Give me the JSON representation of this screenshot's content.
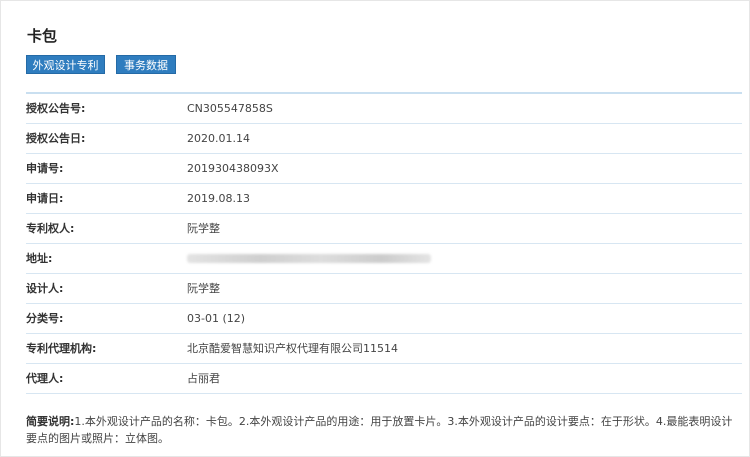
{
  "page": {
    "title": "卡包"
  },
  "buttons": {
    "design_patent": "外观设计专利",
    "transaction_data": "事务数据"
  },
  "fields": [
    {
      "label": "授权公告号:",
      "value": "CN305547858S"
    },
    {
      "label": "授权公告日:",
      "value": "2020.01.14"
    },
    {
      "label": "申请号:",
      "value": "201930438093X"
    },
    {
      "label": "申请日:",
      "value": "2019.08.13"
    },
    {
      "label": "专利权人:",
      "value": "阮学整"
    },
    {
      "label": "地址:",
      "value": ""
    },
    {
      "label": "设计人:",
      "value": "阮学整"
    },
    {
      "label": "分类号:",
      "value": "03-01 (12)"
    },
    {
      "label": "专利代理机构:",
      "value": "北京酷爱智慧知识产权代理有限公司11514"
    },
    {
      "label": "代理人:",
      "value": "占丽君"
    }
  ],
  "description": {
    "label": "简要说明:",
    "text": "1.本外观设计产品的名称：卡包。2.本外观设计产品的用途：用于放置卡片。3.本外观设计产品的设计要点：在于形状。4.最能表明设计要点的图片或照片：立体图。"
  }
}
